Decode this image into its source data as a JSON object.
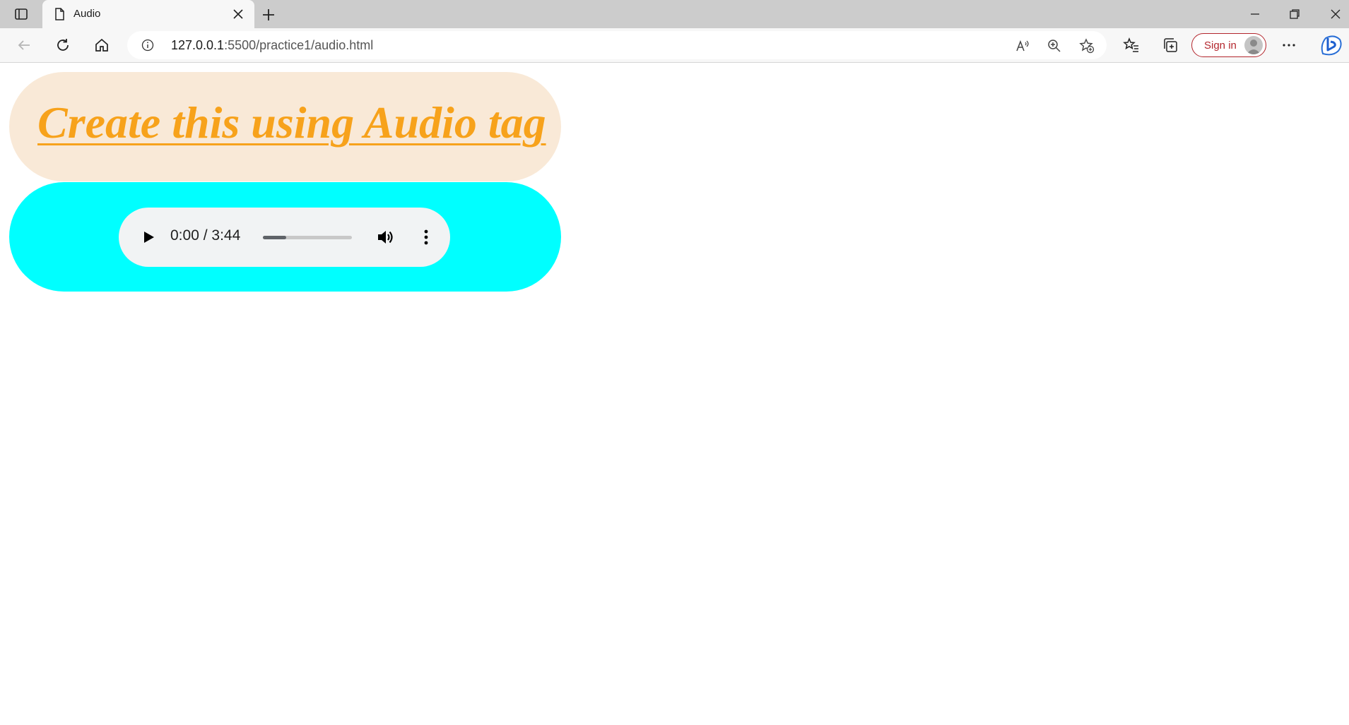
{
  "browser": {
    "tab": {
      "title": "Audio"
    },
    "address": {
      "host": "127.0.0.1",
      "rest": ":5500/practice1/audio.html"
    },
    "signin_label": "Sign in"
  },
  "page": {
    "heading": "Create this using Audio tag",
    "colors": {
      "heading_bg": "#f9e9d7",
      "heading_text": "#f7a21b",
      "player_bg": "#00ffff"
    },
    "audio": {
      "current_time": "0:00",
      "separator": " / ",
      "duration": "3:44",
      "buffered_fraction": 0.26
    }
  }
}
